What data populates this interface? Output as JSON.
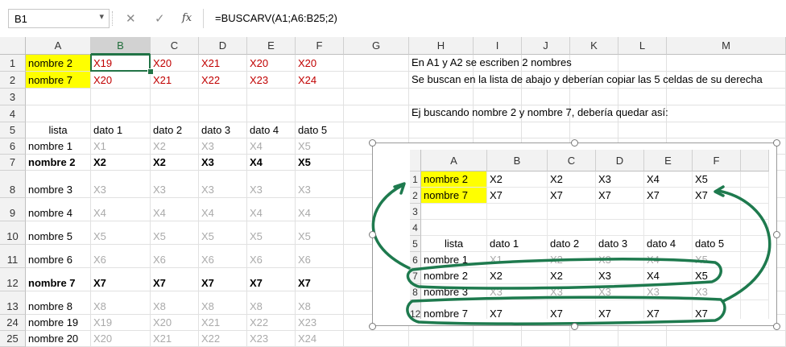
{
  "formula_bar": {
    "name_box": "B1",
    "name_box_dropdown": "▾",
    "cancel_icon": "✕",
    "enter_icon": "✓",
    "fx_icon": "fx",
    "formula": "=BUSCARV(A1;A6:B25;2)"
  },
  "colors": {
    "green": "#217346",
    "highlight": "#ffff00",
    "red_text": "#c00000",
    "gray_text": "#aaaaaa",
    "annotation": "#1e7a4e"
  },
  "grid": {
    "columns": [
      "A",
      "B",
      "C",
      "D",
      "E",
      "F",
      "G",
      "H",
      "I",
      "J",
      "K",
      "L",
      "M"
    ],
    "selected_column": "B",
    "selected_cell": "B1",
    "rows": [
      {
        "n": "1",
        "cells": [
          "nombre 2",
          "X19",
          "X20",
          "X21",
          "X20",
          "X20"
        ]
      },
      {
        "n": "2",
        "cells": [
          "nombre 7",
          "X20",
          "X21",
          "X22",
          "X23",
          "X24"
        ]
      },
      {
        "n": "3",
        "cells": [
          "",
          "",
          "",
          "",
          "",
          ""
        ]
      },
      {
        "n": "4",
        "cells": [
          "",
          "",
          "",
          "",
          "",
          ""
        ]
      },
      {
        "n": "5",
        "cells": [
          "lista",
          "dato 1",
          "dato 2",
          "dato 3",
          "dato 4",
          "dato 5"
        ]
      },
      {
        "n": "6",
        "cells": [
          "nombre 1",
          "X1",
          "X2",
          "X3",
          "X4",
          "X5"
        ]
      },
      {
        "n": "7",
        "cells": [
          "nombre 2",
          "X2",
          "X2",
          "X3",
          "X4",
          "X5"
        ]
      },
      {
        "n": "8",
        "cells": [
          "nombre 3",
          "X3",
          "X3",
          "X3",
          "X3",
          "X3"
        ]
      },
      {
        "n": "9",
        "cells": [
          "nombre 4",
          "X4",
          "X4",
          "X4",
          "X4",
          "X4"
        ]
      },
      {
        "n": "10",
        "cells": [
          "nombre 5",
          "X5",
          "X5",
          "X5",
          "X5",
          "X5"
        ]
      },
      {
        "n": "11",
        "cells": [
          "nombre 6",
          "X6",
          "X6",
          "X6",
          "X6",
          "X6"
        ]
      },
      {
        "n": "12",
        "cells": [
          "nombre 7",
          "X7",
          "X7",
          "X7",
          "X7",
          "X7"
        ]
      },
      {
        "n": "13",
        "cells": [
          "nombre 8",
          "X8",
          "X8",
          "X8",
          "X8",
          "X8"
        ]
      },
      {
        "n": "24",
        "cells": [
          "nombre 19",
          "X19",
          "X20",
          "X21",
          "X22",
          "X23"
        ]
      },
      {
        "n": "25",
        "cells": [
          "nombre 20",
          "X20",
          "X21",
          "X22",
          "X23",
          "X24"
        ]
      }
    ],
    "notes": [
      "En A1 y A2 se escriben 2 nombres",
      "Se buscan en la lista de abajo y deberían copiar las 5 celdas de su derecha",
      "Ej buscando nombre 2 y nombre 7, debería quedar así:"
    ]
  },
  "embedded_image": {
    "columns": [
      "A",
      "B",
      "C",
      "D",
      "E",
      "F"
    ],
    "rows": [
      {
        "n": "1",
        "cells": [
          "nombre 2",
          "X2",
          "X2",
          "X3",
          "X4",
          "X5"
        ]
      },
      {
        "n": "2",
        "cells": [
          "nombre 7",
          "X7",
          "X7",
          "X7",
          "X7",
          "X7"
        ]
      },
      {
        "n": "3",
        "cells": [
          "",
          "",
          "",
          "",
          "",
          ""
        ]
      },
      {
        "n": "4",
        "cells": [
          "",
          "",
          "",
          "",
          "",
          ""
        ]
      },
      {
        "n": "5",
        "cells": [
          "lista",
          "dato 1",
          "dato 2",
          "dato 3",
          "dato 4",
          "dato 5"
        ]
      },
      {
        "n": "6",
        "cells": [
          "nombre 1",
          "X1",
          "X2",
          "X3",
          "X4",
          "X5"
        ]
      },
      {
        "n": "7",
        "cells": [
          "nombre 2",
          "X2",
          "X2",
          "X3",
          "X4",
          "X5"
        ]
      },
      {
        "n": "8",
        "cells": [
          "nombre 3",
          "X3",
          "X3",
          "X3",
          "X3",
          "X3"
        ]
      },
      {
        "n": "12",
        "cells": [
          "nombre 7",
          "X7",
          "X7",
          "X7",
          "X7",
          "X7"
        ]
      }
    ]
  }
}
